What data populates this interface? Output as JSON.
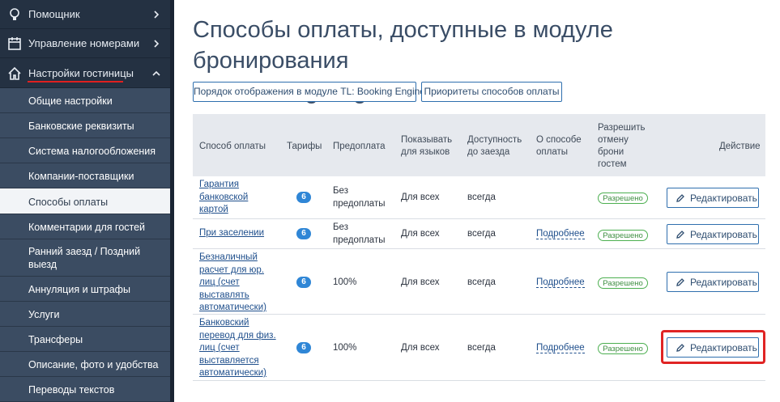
{
  "sidebar": {
    "top_items": [
      {
        "label": "Помощник",
        "icon": "lightbulb-icon",
        "chevron": "chevron-right-icon"
      },
      {
        "label": "Управление номерами",
        "icon": "calendar-icon",
        "chevron": "chevron-right-icon"
      },
      {
        "label": "Настройки гостиницы",
        "icon": "home-icon",
        "chevron": "chevron-up-icon"
      }
    ],
    "sub_items": [
      {
        "label": "Общие настройки"
      },
      {
        "label": "Банковские реквизиты"
      },
      {
        "label": "Система налогообложения"
      },
      {
        "label": "Компании-поставщики"
      },
      {
        "label": "Способы оплаты",
        "active": true
      },
      {
        "label": "Комментарии для гостей"
      },
      {
        "label_line1": "Ранний заезд / Поздний",
        "label_line2": "выезд"
      },
      {
        "label": "Аннуляция и штрафы"
      },
      {
        "label": "Услуги"
      },
      {
        "label": "Трансферы"
      },
      {
        "label": "Описание, фото и удобства"
      },
      {
        "label": "Переводы текстов"
      }
    ]
  },
  "page": {
    "title_line1": "Способы оплаты, доступные в модуле бронирования",
    "title_line2": "TL: Booking Engine",
    "btn_order": "Порядок отображения в модуле TL: Booking Engine",
    "btn_priority": "Приоритеты способов оплаты"
  },
  "table": {
    "headers": {
      "method": "Способ оплаты",
      "tariffs": "Тарифы",
      "prepay": "Предоплата",
      "show_l1": "Показывать",
      "show_l2": "для языков",
      "avail_l1": "Доступность",
      "avail_l2": "до заезда",
      "about_l1": "О способе",
      "about_l2": "оплаты",
      "allow_l1": "Разрешить",
      "allow_l2": "отмену",
      "allow_l3": "брони",
      "allow_l4": "гостем",
      "action": "Действие"
    },
    "rows": [
      {
        "method": [
          "Гарантия",
          "банковской",
          "картой"
        ],
        "tariffs": "6",
        "prepay": [
          "Без",
          "предоплаты"
        ],
        "languages": "Для всех",
        "availability": "всегда",
        "about": "",
        "cancel": "Разрешено",
        "edit": "Редактировать"
      },
      {
        "method": [
          "При заселении"
        ],
        "tariffs": "6",
        "prepay": [
          "Без",
          "предоплаты"
        ],
        "languages": "Для всех",
        "availability": "всегда",
        "about": "Подробнее",
        "cancel": "Разрешено",
        "edit": "Редактировать"
      },
      {
        "method": [
          "Безналичный",
          "расчет для юр.",
          "лиц (счет",
          "выставлять",
          "автоматически)"
        ],
        "tariffs": "6",
        "prepay": [
          "100%"
        ],
        "languages": "Для всех",
        "availability": "всегда",
        "about": "Подробнее",
        "cancel": "Разрешено",
        "edit": "Редактировать"
      },
      {
        "method": [
          "Банковский",
          "перевод для физ.",
          "лиц (счет",
          "выставляется",
          "автоматически)"
        ],
        "tariffs": "6",
        "prepay": [
          "100%"
        ],
        "languages": "Для всех",
        "availability": "всегда",
        "about": "Подробнее",
        "cancel": "Разрешено",
        "edit": "Редактировать"
      }
    ]
  },
  "colors": {
    "sidebar_bg": "#243142",
    "submenu_bg": "#3b4c62",
    "accent": "#2f6fae",
    "highlight": "#e02424",
    "badge": "#2f86d6",
    "success": "#4caf50"
  }
}
